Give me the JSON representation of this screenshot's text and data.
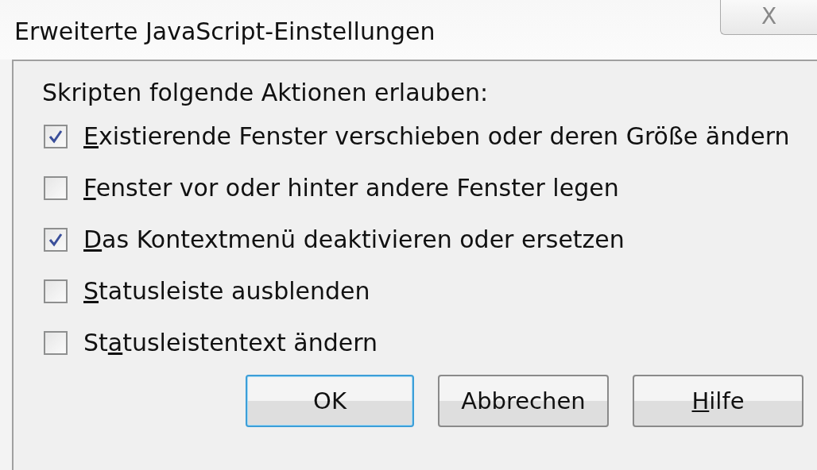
{
  "window": {
    "title": "Erweiterte JavaScript-Einstellungen",
    "close": "X"
  },
  "heading": "Skripten folgende Aktionen erlauben:",
  "options": [
    {
      "label": {
        "key": "E",
        "post": "xistierende Fenster verschieben oder deren Größe ändern"
      },
      "checked": true
    },
    {
      "label": {
        "key": "F",
        "post": "enster vor oder hinter andere Fenster legen"
      },
      "checked": false
    },
    {
      "label": {
        "key": "D",
        "post": "as Kontextmenü deaktivieren oder ersetzen"
      },
      "checked": true
    },
    {
      "label": {
        "key": "S",
        "post": "tatusleiste ausblenden"
      },
      "checked": false
    },
    {
      "label": {
        "pre": "St",
        "key": "a",
        "post": "tusleistentext ändern"
      },
      "checked": false
    }
  ],
  "buttons": [
    {
      "label": {
        "pre": "OK"
      },
      "default": true
    },
    {
      "label": {
        "pre": "Abbrechen"
      },
      "default": false
    },
    {
      "label": {
        "key": "H",
        "post": "ilfe"
      },
      "default": false
    }
  ]
}
